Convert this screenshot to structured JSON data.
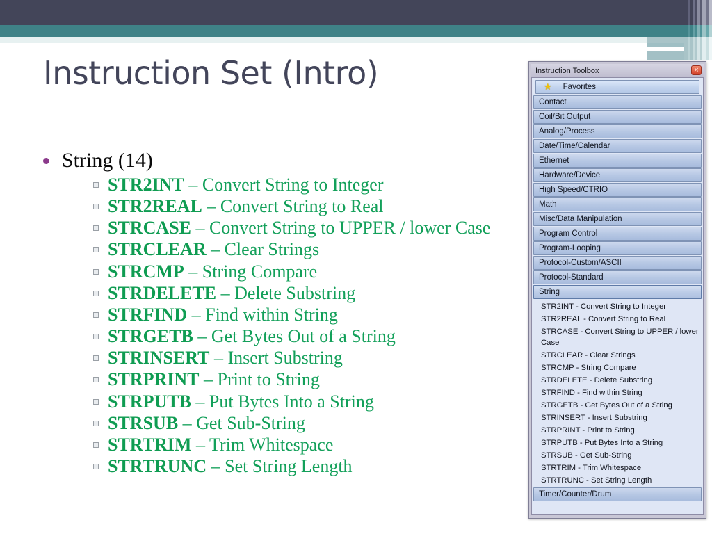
{
  "slide": {
    "title": "Instruction Set (Intro)"
  },
  "content": {
    "heading": "String (14)",
    "items": [
      {
        "name": "STR2INT",
        "sep": " – ",
        "desc": "Convert String to Integer"
      },
      {
        "name": "STR2REAL",
        "sep": " – ",
        "desc": "Convert String to Real"
      },
      {
        "name": "STRCASE",
        "sep": " – ",
        "desc": "Convert String to UPPER / lower Case"
      },
      {
        "name": "STRCLEAR",
        "sep": " – ",
        "desc": "Clear Strings"
      },
      {
        "name": "STRCMP",
        "sep": " – ",
        "desc": "String Compare"
      },
      {
        "name": "STRDELETE",
        "sep": " – ",
        "desc": "Delete Substring"
      },
      {
        "name": "STRFIND",
        "sep": " – ",
        "desc": "Find within String"
      },
      {
        "name": "STRGETB",
        "sep": " – ",
        "desc": "Get Bytes Out of a String"
      },
      {
        "name": "STRINSERT",
        "sep": " – ",
        "desc": "Insert Substring"
      },
      {
        "name": "STRPRINT",
        "sep": " – ",
        "desc": "Print to String"
      },
      {
        "name": "STRPUTB",
        "sep": " – ",
        "desc": "Put Bytes Into a String"
      },
      {
        "name": "STRSUB",
        "sep": " – ",
        "desc": "Get Sub-String"
      },
      {
        "name": "STRTRIM",
        "sep": " – ",
        "desc": "Trim Whitespace"
      },
      {
        "name": "STRTRUNC",
        "sep": " – ",
        "desc": "Set String Length"
      }
    ]
  },
  "toolbox": {
    "title": "Instruction Toolbox",
    "close_label": "×",
    "favorites_label": "Favorites",
    "favorites_icon": "star-icon",
    "categories_before": [
      "Contact",
      "Coil/Bit Output",
      "Analog/Process",
      "Date/Time/Calendar",
      "Ethernet",
      "Hardware/Device",
      "High Speed/CTRIO",
      "Math",
      "Misc/Data Manipulation",
      "Program Control",
      "Program-Looping",
      "Protocol-Custom/ASCII",
      "Protocol-Standard"
    ],
    "selected_category": "String",
    "string_items": [
      "STR2INT - Convert String to Integer",
      "STR2REAL - Convert String to Real",
      "STRCASE - Convert String to UPPER / lower Case",
      "STRCLEAR - Clear Strings",
      "STRCMP - String Compare",
      "STRDELETE - Delete Substring",
      "STRFIND - Find within String",
      "STRGETB - Get Bytes Out of a String",
      "STRINSERT - Insert Substring",
      "STRPRINT - Print to String",
      "STRPUTB - Put Bytes Into a String",
      "STRSUB - Get Sub-String",
      "STRTRIM - Trim Whitespace",
      "STRTRUNC - Set String Length"
    ],
    "categories_after": [
      "Timer/Counter/Drum"
    ]
  },
  "colors": {
    "band_dark": "#434559",
    "band_teal": "#3f8287",
    "title_text": "#43455a",
    "instruction_green": "#13a05a",
    "bullet_purple": "#8b3a8b",
    "panel_frame": "#c9c7d6",
    "panel_body": "#dfe6f5",
    "category_bar": "#b7c8e4",
    "close_button": "#d2402a"
  }
}
